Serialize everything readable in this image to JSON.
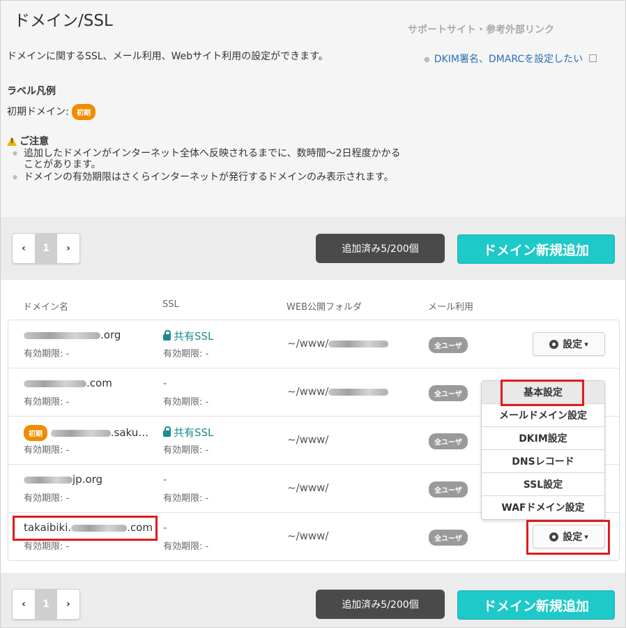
{
  "page": {
    "title": "ドメイン/SSL",
    "description": "ドメインに関するSSL、メール利用、Webサイト利用の設定ができます。"
  },
  "support": {
    "heading": "サポートサイト・参考外部リンク",
    "link": "DKIM署名、DMARCを設定したい"
  },
  "legend": {
    "heading": "ラベル凡例",
    "label": "初期ドメイン:",
    "badge": "初期"
  },
  "notice": {
    "heading": "ご注意",
    "items": [
      "追加したドメインがインターネット全体へ反映されるまでに、数時間〜2日程度かかることがあります。",
      "ドメインの有効期限はさくらインターネットが発行するドメインのみ表示されます。"
    ]
  },
  "toolbar": {
    "prev": "‹",
    "page": "1",
    "next": "›",
    "count": "追加済み5/200個",
    "add": "ドメイン新規追加"
  },
  "columns": [
    "ドメイン名",
    "SSL",
    "WEB公開フォルダ",
    "メール利用"
  ],
  "rows": [
    {
      "domain": ".org",
      "expiry": "有効期限: -",
      "ssl": "共有SSL",
      "ssl_expiry": "有効期限: -",
      "folder": "~/www/",
      "mail": "全ユーザ"
    },
    {
      "domain": ".com",
      "expiry": "有効期限: -",
      "ssl": "-",
      "ssl_expiry": "有効期限: -",
      "folder": "~/www/",
      "mail": "全ユーザ"
    },
    {
      "domain": ".saku…",
      "expiry": "有効期限: -",
      "ssl": "共有SSL",
      "ssl_expiry": "有効期限: -",
      "folder": "~/www/",
      "mail": "全ユーザ",
      "badge": "初期"
    },
    {
      "domain": "jp.org",
      "expiry": "有効期限: -",
      "ssl": "-",
      "ssl_expiry": "有効期限: -",
      "folder": "~/www/",
      "mail": "全ユーザ"
    },
    {
      "domain_prefix": "takaibiki.",
      "domain": ".com",
      "expiry": "有効期限: -",
      "ssl": "-",
      "ssl_expiry": "有効期限: -",
      "folder": "~/www/",
      "mail": "全ユーザ"
    }
  ],
  "settings_button": "設定",
  "menu": [
    "基本設定",
    "メールドメイン設定",
    "DKIM設定",
    "DNSレコード",
    "SSL設定",
    "WAFドメイン設定"
  ],
  "colors": {
    "accent": "#1ec9c9",
    "badge_orange": "#f08c00",
    "highlight": "#e01b1b",
    "link": "#2a6fb5"
  }
}
